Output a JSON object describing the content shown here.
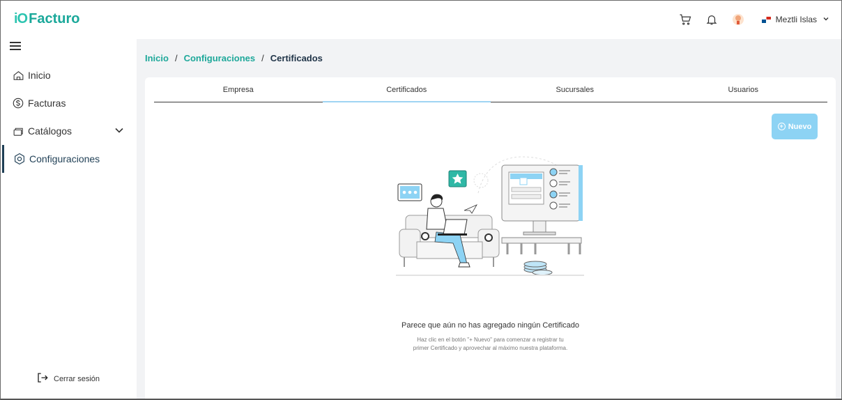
{
  "app": {
    "logo_mark": "iO",
    "logo_text": "Facturo"
  },
  "header": {
    "cart_icon": "cart-icon",
    "bell_icon": "bell-icon",
    "user_name": "Meztli Islas"
  },
  "sidebar": {
    "items": [
      {
        "label": "Inicio",
        "icon": "home-icon"
      },
      {
        "label": "Facturas",
        "icon": "dollar-circle-icon"
      },
      {
        "label": "Catálogos",
        "icon": "folders-icon"
      },
      {
        "label": "Configuraciones",
        "icon": "gear-icon"
      }
    ],
    "logout_label": "Cerrar sesión"
  },
  "breadcrumb": {
    "home": "Inicio",
    "section": "Configuraciones",
    "current": "Certificados",
    "separator": "/"
  },
  "tabs": [
    "Empresa",
    "Certificados",
    "Sucursales",
    "Usuarios"
  ],
  "active_tab": "Certificados",
  "new_button": {
    "label": "Nuevo",
    "icon": "plus-circle-icon"
  },
  "empty_state": {
    "title": "Parece que aún no has agregado ningún Certificado",
    "subtitle": "Haz clic en el botón \"+ Nuevo\" para comenzar a registrar tu primer Certificado y aprovechar al máximo nuestra plataforma."
  },
  "colors": {
    "brand": "#1aa89a",
    "accent": "#8dd3f4",
    "active_nav": "#1f3f55"
  }
}
